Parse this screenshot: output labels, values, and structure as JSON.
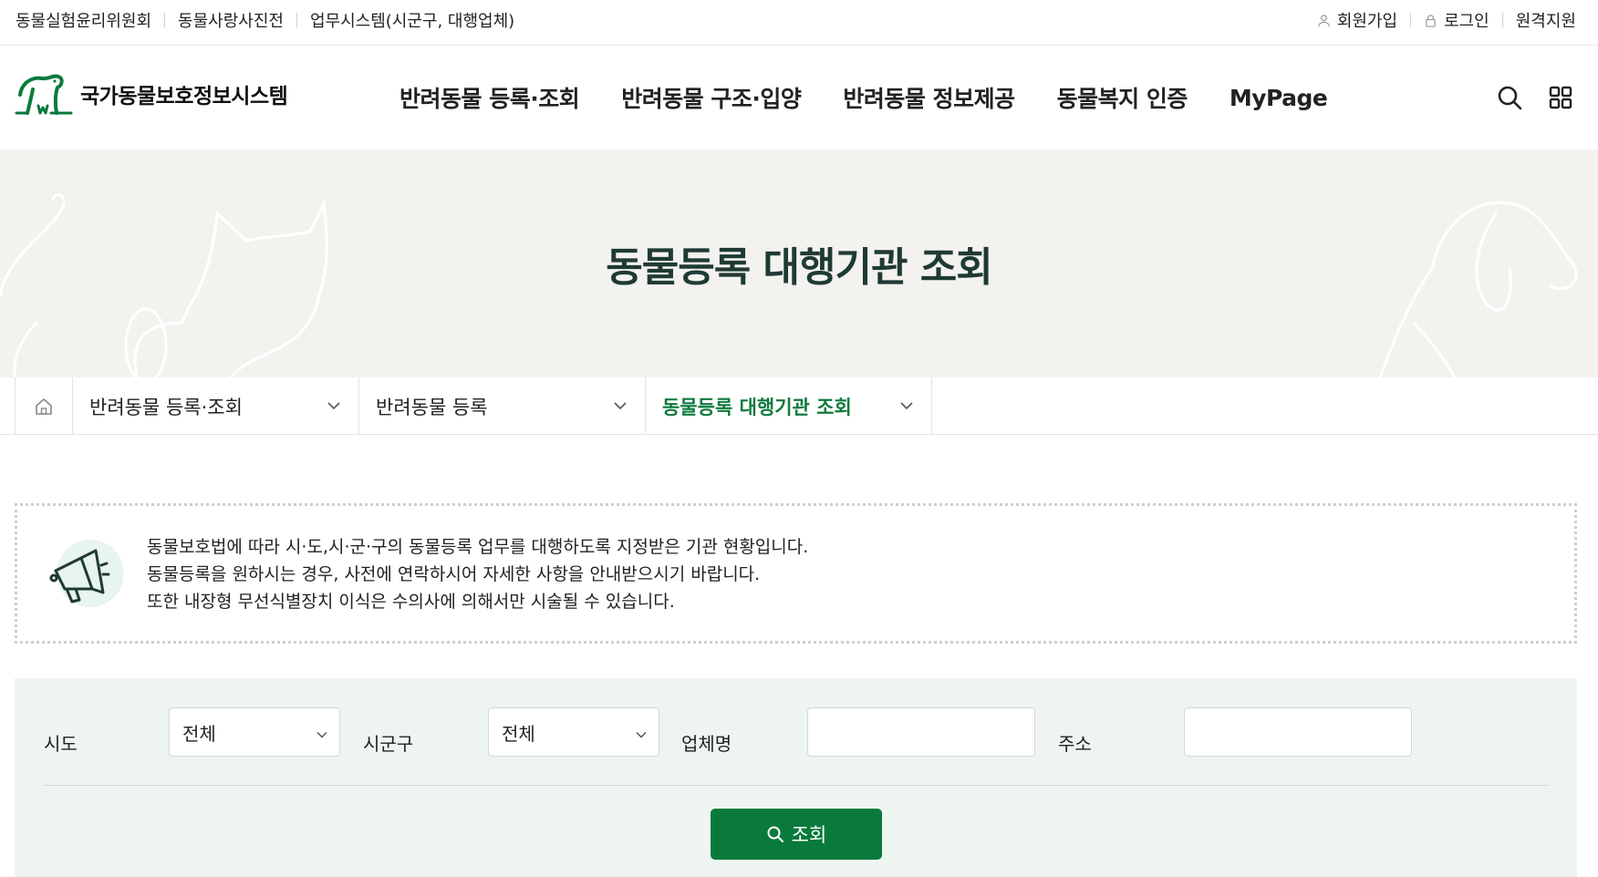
{
  "topbar": {
    "left_links": [
      "동물실험윤리위원회",
      "동물사랑사진전",
      "업무시스템(시군구, 대행업체)"
    ],
    "signup": "회원가입",
    "login": "로그인",
    "remote": "원격지원"
  },
  "header": {
    "logo_text": "국가동물보호정보시스템",
    "nav": [
      "반려동물 등록·조회",
      "반려동물 구조·입양",
      "반려동물 정보제공",
      "동물복지 인증",
      "MyPage"
    ]
  },
  "hero": {
    "title": "동물등록 대행기관 조회"
  },
  "breadcrumb": {
    "items": [
      "반려동물 등록·조회",
      "반려동물 등록",
      "동물등록 대행기관 조회"
    ]
  },
  "notice": {
    "lines": [
      "동물보호법에 따라 시·도,시·군·구의 동물등록 업무를 대행하도록 지정받은 기관 현황입니다.",
      "동물등록을 원하시는 경우, 사전에 연락하시어 자세한 사항을 안내받으시기 바랍니다.",
      "또한 내장형 무선식별장치 이식은 수의사에 의해서만 시술될 수 있습니다."
    ]
  },
  "search": {
    "sido_label": "시도",
    "sido_value": "전체",
    "sigungu_label": "시군구",
    "sigungu_value": "전체",
    "company_label": "업체명",
    "company_value": "",
    "address_label": "주소",
    "address_value": "",
    "submit_label": "조회"
  },
  "colors": {
    "brand_green": "#0a7a3c",
    "hero_bg": "#f3f2ef",
    "title_dark": "#1f3a34",
    "search_bg": "#eef5f1"
  }
}
